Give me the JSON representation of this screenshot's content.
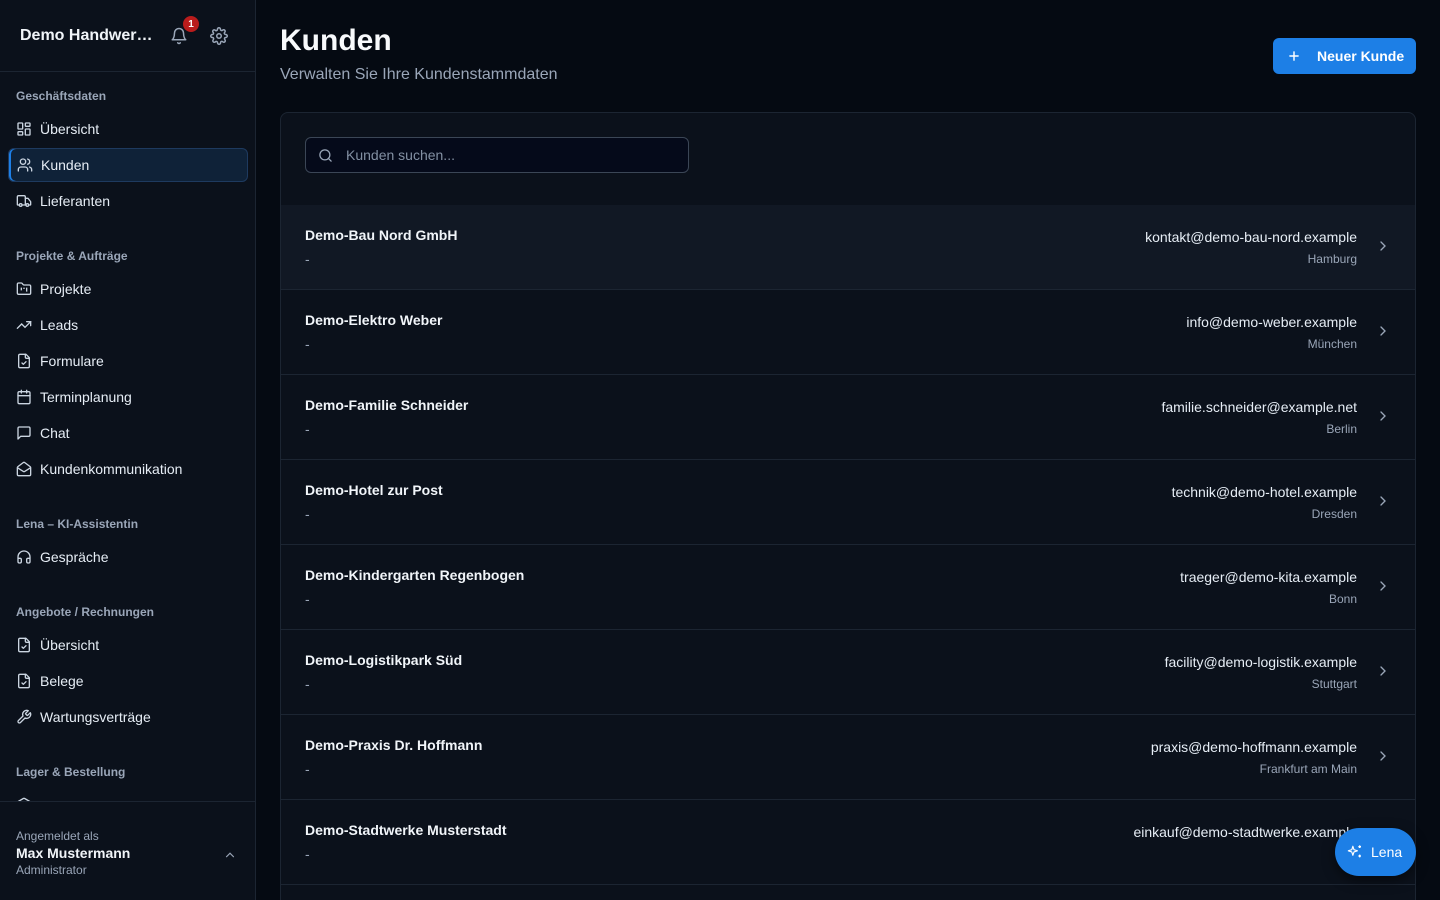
{
  "sidebar": {
    "app_title": "Demo Handwerksbetrieb",
    "notification_count": "1",
    "sections": [
      {
        "label": "Geschäftsdaten",
        "items": [
          {
            "label": "Übersicht",
            "icon": "dashboard-icon"
          },
          {
            "label": "Kunden",
            "icon": "users-icon",
            "active": true
          },
          {
            "label": "Lieferanten",
            "icon": "truck-icon"
          }
        ]
      },
      {
        "label": "Projekte & Aufträge",
        "items": [
          {
            "label": "Projekte",
            "icon": "folder-icon"
          },
          {
            "label": "Leads",
            "icon": "trending-up-icon"
          },
          {
            "label": "Formulare",
            "icon": "file-check-icon"
          },
          {
            "label": "Terminplanung",
            "icon": "calendar-icon"
          },
          {
            "label": "Chat",
            "icon": "message-square-icon"
          },
          {
            "label": "Kundenkommunikation",
            "icon": "mail-open-icon"
          }
        ]
      },
      {
        "label": "Lena – KI-Assistentin",
        "items": [
          {
            "label": "Gespräche",
            "icon": "headphones-icon"
          }
        ]
      },
      {
        "label": "Angebote / Rechnungen",
        "items": [
          {
            "label": "Übersicht",
            "icon": "file-check-icon"
          },
          {
            "label": "Belege",
            "icon": "receipt-icon"
          },
          {
            "label": "Wartungsverträge",
            "icon": "wrench-icon"
          }
        ]
      },
      {
        "label": "Lager & Bestellung",
        "items": []
      }
    ],
    "footer": {
      "label": "Angemeldet als",
      "name": "Max Mustermann",
      "role": "Administrator"
    }
  },
  "main": {
    "title": "Kunden",
    "subtitle": "Verwalten Sie Ihre Kundenstammdaten",
    "new_button_label": "Neuer Kunde",
    "search_placeholder": "Kunden suchen...",
    "customers": [
      {
        "name": "Demo-Bau Nord GmbH",
        "sub": "-",
        "email": "kontakt@demo-bau-nord.example",
        "city": "Hamburg"
      },
      {
        "name": "Demo-Elektro Weber",
        "sub": "-",
        "email": "info@demo-weber.example",
        "city": "München"
      },
      {
        "name": "Demo-Familie Schneider",
        "sub": "-",
        "email": "familie.schneider@example.net",
        "city": "Berlin"
      },
      {
        "name": "Demo-Hotel zur Post",
        "sub": "-",
        "email": "technik@demo-hotel.example",
        "city": "Dresden"
      },
      {
        "name": "Demo-Kindergarten Regenbogen",
        "sub": "-",
        "email": "traeger@demo-kita.example",
        "city": "Bonn"
      },
      {
        "name": "Demo-Logistikpark Süd",
        "sub": "-",
        "email": "facility@demo-logistik.example",
        "city": "Stuttgart"
      },
      {
        "name": "Demo-Praxis Dr. Hoffmann",
        "sub": "-",
        "email": "praxis@demo-hoffmann.example",
        "city": "Frankfurt am Main"
      },
      {
        "name": "Demo-Stadtwerke Musterstadt",
        "sub": "-",
        "email": "einkauf@demo-stadtwerke.example",
        "city": ""
      }
    ]
  },
  "assistant_button": {
    "label": "Lena"
  },
  "colors": {
    "accent": "#1d7fe6",
    "background": "#050a12",
    "panel": "#0b111b",
    "badge": "#b91c1c"
  }
}
